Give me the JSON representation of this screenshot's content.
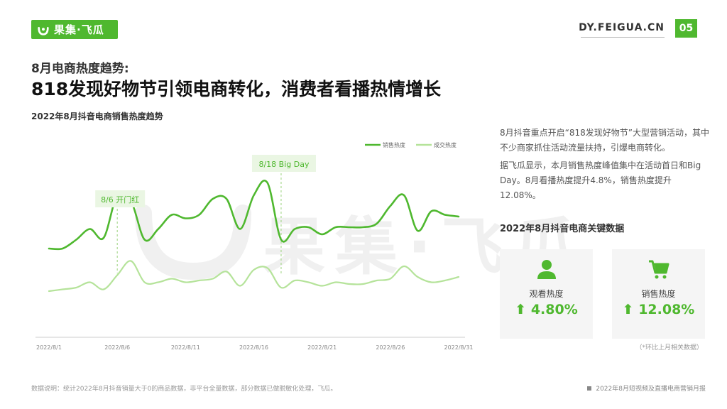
{
  "logo": {
    "text": "果集·飞瓜"
  },
  "header": {
    "site": "DY.FEIGUA.CN",
    "page_number": "05"
  },
  "subtitle": "8月电商热度趋势:",
  "title": "818发现好物节引领电商转化，消费者看播热情增长",
  "chart_title": "2022年8月抖音电商销售热度趋势",
  "watermark": "果集·飞瓜",
  "colors": {
    "accent": "#4fb82f",
    "series_light": "#b5e39a"
  },
  "chart_data": {
    "type": "line",
    "x_ticks": [
      "2022/8/1",
      "2022/8/6",
      "2022/8/11",
      "2022/8/16",
      "2022/8/21",
      "2022/8/26",
      "2022/8/31"
    ],
    "x_tick_days": [
      1,
      6,
      11,
      16,
      21,
      26,
      31
    ],
    "x_days": [
      1,
      2,
      3,
      4,
      5,
      6,
      7,
      8,
      9,
      10,
      11,
      12,
      13,
      14,
      15,
      16,
      17,
      18,
      19,
      20,
      21,
      22,
      23,
      24,
      25,
      26,
      27,
      28,
      29,
      30,
      31
    ],
    "series": [
      {
        "name": "销售热度",
        "color": "#4fb82f",
        "values": [
          50,
          50,
          55,
          61,
          56,
          80,
          77,
          55,
          61,
          69,
          67,
          69,
          78,
          78,
          61,
          80,
          87,
          55,
          61,
          62,
          58,
          62,
          62,
          62,
          64,
          74,
          80,
          60,
          71,
          69,
          68
        ]
      },
      {
        "name": "成交热度",
        "color": "#b5e39a",
        "values": [
          26,
          27,
          28,
          31,
          27,
          35,
          43,
          31,
          31,
          33,
          31,
          32,
          33,
          37,
          29,
          38,
          39,
          28,
          32,
          31,
          29,
          31,
          30,
          30,
          32,
          33,
          40,
          34,
          31,
          32,
          34
        ]
      }
    ],
    "ylim": [
      0,
      110
    ],
    "legend_position": "top-right",
    "annotations": [
      {
        "label": "8/6 开门红",
        "day": 6
      },
      {
        "label": "8/18 Big Day",
        "day": 18
      }
    ]
  },
  "description": {
    "p1": "8月抖音重点开启“818发现好物节”大型营销活动，其中不少商家抓住活动流量扶持，引爆电商转化。",
    "p2": "据飞瓜显示，本月销售热度峰值集中在活动首日和Big Day。8月看播热度提升4.8%，销售热度提升12.08%。"
  },
  "kpi": {
    "title": "2022年8月抖音电商关键数据",
    "cards": [
      {
        "label": "观看热度",
        "value": "4.80%",
        "icon": "person-icon"
      },
      {
        "label": "销售热度",
        "value": "12.08%",
        "icon": "shopping-cart-icon"
      }
    ],
    "note": "（*环比上月相关数据）"
  },
  "footnote": "数据说明：统计2022年8月抖音销量大于0的商品数据，非平台全量数据，部分数据已做脱敏化处理，飞瓜。",
  "footer_right": "2022年8月短视频及直播电商营销月报"
}
